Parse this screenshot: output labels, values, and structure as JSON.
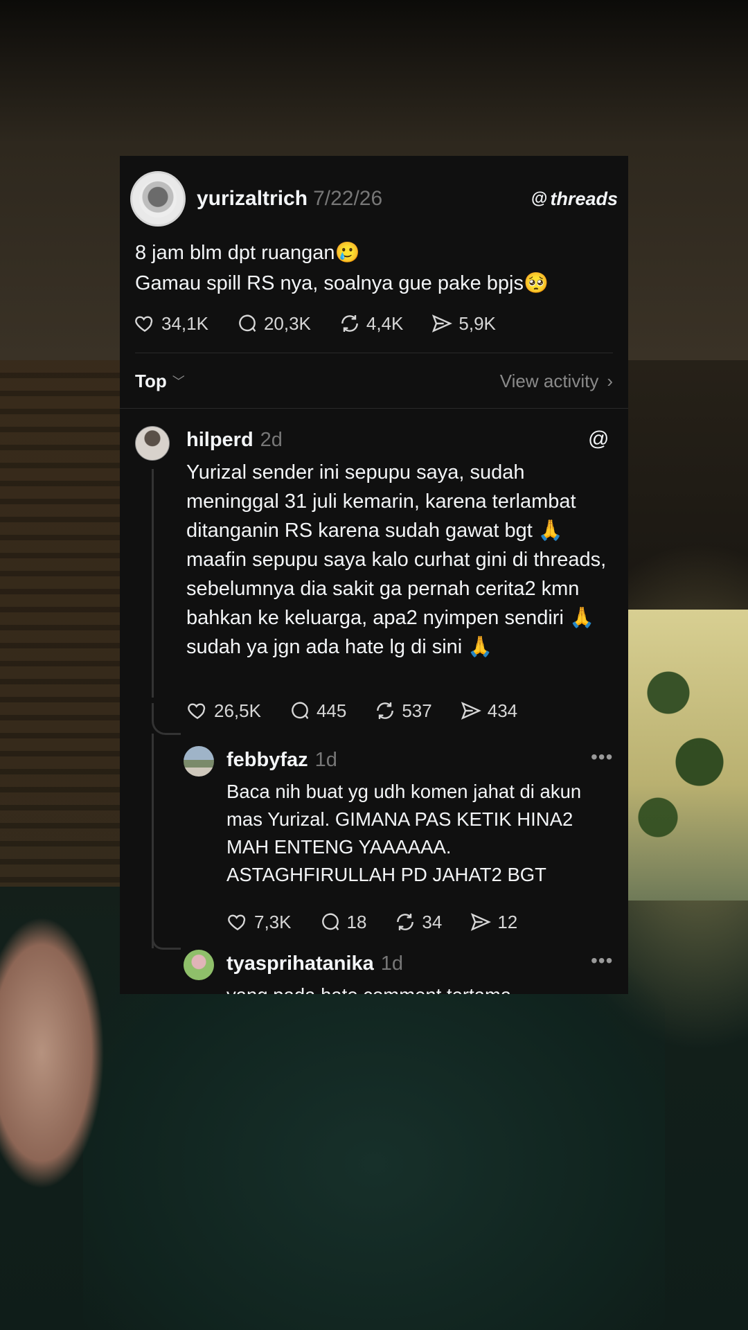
{
  "post": {
    "username": "yurizaltrich",
    "date": "7/22/26",
    "brand": "threads",
    "text_line1": "8 jam blm dpt ruangan🥲",
    "text_line2": "Gamau spill RS nya, soalnya gue pake bpjs🥺",
    "likes": "34,1K",
    "comments": "20,3K",
    "reposts": "4,4K",
    "shares": "5,9K"
  },
  "filter": {
    "sort_label": "Top",
    "view_activity": "View activity"
  },
  "replies": [
    {
      "username": "hilperd",
      "time": "2d",
      "text": "Yurizal sender ini sepupu saya, sudah meninggal 31 juli kemarin, karena terlambat ditanganin RS karena sudah gawat bgt 🙏 maafin sepupu saya kalo curhat gini di threads, sebelumnya dia sakit ga pernah cerita2 kmn bahkan ke keluarga, apa2 nyimpen sendiri 🙏 sudah ya jgn ada hate lg di sini 🙏",
      "likes": "26,5K",
      "comments": "445",
      "reposts": "537",
      "shares": "434"
    },
    {
      "username": "febbyfaz",
      "time": "1d",
      "text": "Baca nih buat yg udh komen jahat di akun mas Yurizal. GIMANA PAS KETIK HINA2 MAH ENTENG YAAAAAA. ASTAGHFIRULLAH PD JAHAT2 BGT",
      "likes": "7,3K",
      "comments": "18",
      "reposts": "34",
      "shares": "12"
    },
    {
      "username": "tyasprihatanika",
      "time": "1d",
      "text": "yang pada hate comment tertama"
    }
  ],
  "icons": {
    "threads_logo": "threads-logo-icon",
    "more": "more-dots-icon",
    "like": "heart-icon",
    "comment": "comment-icon",
    "repost": "repost-icon",
    "share": "share-icon"
  },
  "colors": {
    "card_bg": "#101010",
    "text_primary": "#f3f5f7",
    "text_secondary": "#777777"
  }
}
